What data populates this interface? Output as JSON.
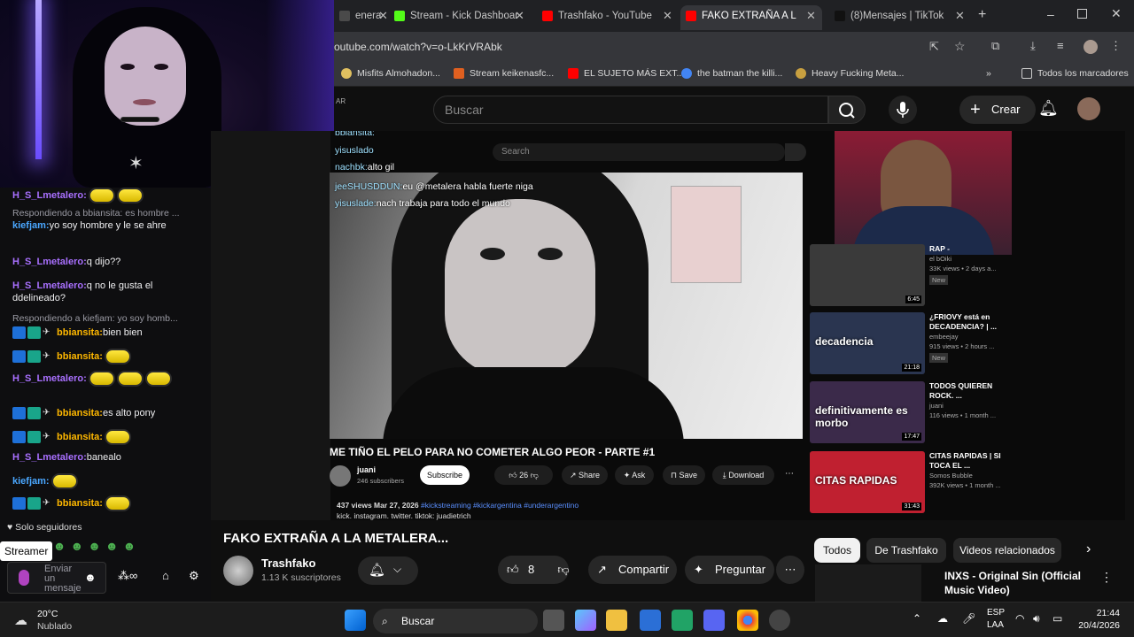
{
  "browser": {
    "tabs": [
      {
        "label": "enera",
        "icon": "chrome-tab-icon",
        "color": "#4a4a4a"
      },
      {
        "label": "Stream - Kick Dashboar",
        "icon": "kick-icon",
        "color": "#53fc18"
      },
      {
        "label": "Trashfako - YouTube",
        "icon": "youtube-icon",
        "color": "#ff0000"
      },
      {
        "label": "FAKO EXTRAÑA A L",
        "icon": "youtube-icon",
        "color": "#ff0000"
      },
      {
        "label": "(8)Mensajes | TikTok",
        "icon": "tiktok-icon",
        "color": "#111111"
      }
    ],
    "url": "outube.com/watch?v=o-LkKrVRAbk",
    "bookmarks": [
      "Misfits Almohadon...",
      "Stream keikenasfc...",
      "EL SUJETO MÁS EXT...",
      "the batman the killi...",
      "Heavy Fucking Meta..."
    ],
    "all_bookmarks": "Todos los marcadores"
  },
  "youtube": {
    "country": "AR",
    "search_placeholder": "Buscar",
    "create_label": "Crear",
    "video_title": "FAKO EXTRAÑA A LA METALERA...",
    "channel": "Trashfako",
    "subscribers": "1.13 K suscriptores",
    "likes": "8",
    "share_label": "Compartir",
    "ask_label": "Preguntar",
    "chips": [
      "Todos",
      "De Trashfako",
      "Videos relacionados"
    ],
    "rec_title": "INXS - Original Sin (Official Music Video)"
  },
  "inner_video": {
    "search_placeholder": "Search",
    "overlay_chat": [
      {
        "user": "bbiansita:",
        "text": ""
      },
      {
        "user": "yisuslado",
        "text": ""
      },
      {
        "user": "nachbk:",
        "text": "alto gil"
      },
      {
        "user": "jeeSHUSDDUN:",
        "text": "eu @metalera habla fuerte niga"
      },
      {
        "user": "yisuslade:",
        "text": "nach trabaja para todo el mundo"
      }
    ],
    "title": "ME TIÑO EL PELO PARA NO COMETER ALGO PEOR - PARTE #1",
    "channel": "juani",
    "subs": "246 subscribers",
    "subscribe": "Subscribe",
    "likes": "26",
    "share": "Share",
    "ask": "Ask",
    "save": "Save",
    "download": "Download",
    "meta": "437 views  Mar 27, 2026",
    "hashtags": "#kickstreaming #kickargentina #underargentino",
    "desc": "kick. instagram. twitter. tiktok: juadietrich",
    "sidebar": [
      {
        "title": "RAP -",
        "channel": "el bOiki",
        "meta": "33K views • 2 days a...",
        "badge": "New",
        "dur": "6:45",
        "color": "#3a3a3a"
      },
      {
        "title": "¿FRIOVY está en DECADENCIA? | ...",
        "channel": "embeejay",
        "meta": "915 views • 2 hours ...",
        "badge": "New",
        "dur": "21:18",
        "color": "#2a3550",
        "overlay": "decadencia"
      },
      {
        "title": "TODOS QUIEREN ROCK. ...",
        "channel": "juani",
        "meta": "116 views • 1 month ...",
        "badge": "",
        "dur": "17:47",
        "color": "#3b2a4a",
        "overlay": "definitivamente es morbo"
      },
      {
        "title": "CITAS RAPIDAS | SI TOCA EL ...",
        "channel": "Somos Bubble",
        "meta": "392K views • 1 month ...",
        "badge": "",
        "dur": "31:43",
        "color": "#c02030",
        "overlay": "CITAS RAPIDAS"
      }
    ]
  },
  "chat": {
    "messages": [
      {
        "type": "msg",
        "user": "H_S_Lmetalero:",
        "ucls": "u1",
        "text": "",
        "emotes": 2
      },
      {
        "type": "reply",
        "text": "Respondiendo a bbiansita: es hombre ..."
      },
      {
        "type": "msg",
        "user": "kiefjam:",
        "ucls": "u2",
        "text": "yo soy hombre y le se ahre",
        "emotes": 0
      },
      {
        "type": "msg",
        "user": "H_S_Lmetalero:",
        "ucls": "u1",
        "text": "q dijo??",
        "emotes": 0
      },
      {
        "type": "msg",
        "user": "H_S_Lmetalero:",
        "ucls": "u1",
        "text": "q no le gusta el ddelineado?",
        "emotes": 0
      },
      {
        "type": "reply",
        "text": "Respondiendo a kiefjam: yo soy homb..."
      },
      {
        "type": "msg",
        "user": "bbiansita:",
        "ucls": "u3",
        "text": "bien bien",
        "emotes": 0,
        "badges": true
      },
      {
        "type": "msg",
        "user": "bbiansita:",
        "ucls": "u3",
        "text": "",
        "emotes": 1,
        "badges": true
      },
      {
        "type": "msg",
        "user": "H_S_Lmetalero:",
        "ucls": "u1",
        "text": "",
        "emotes": 3
      },
      {
        "type": "msg",
        "user": "bbiansita:",
        "ucls": "u3",
        "text": "es alto pony",
        "emotes": 0,
        "badges": true
      },
      {
        "type": "msg",
        "user": "bbiansita:",
        "ucls": "u3",
        "text": "",
        "emotes": 1,
        "badges": true
      },
      {
        "type": "msg",
        "user": "H_S_Lmetalero:",
        "ucls": "u1",
        "text": "banealo",
        "emotes": 0
      },
      {
        "type": "msg",
        "user": "kiefjam:",
        "ucls": "u2",
        "text": "",
        "emotes": 1
      },
      {
        "type": "msg",
        "user": "bbiansita:",
        "ucls": "u3",
        "text": "",
        "emotes": 1,
        "badges": true
      }
    ],
    "followers_only": "Solo seguidores",
    "tooltip": "Streamer",
    "send_placeholder": "Enviar un mensaje"
  },
  "taskbar": {
    "weather_temp": "20°C",
    "weather_desc": "Nublado",
    "search_label": "Buscar",
    "lang1": "ESP",
    "lang2": "LAA",
    "time": "21:44",
    "date": "20/4/2026"
  }
}
